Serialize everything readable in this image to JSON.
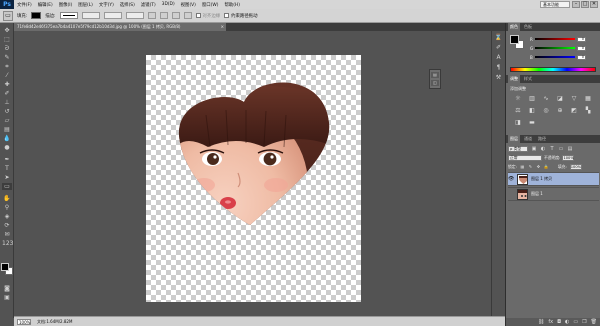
{
  "app": {
    "logo": "Ps"
  },
  "menu": [
    "文件(F)",
    "编辑(E)",
    "图像(I)",
    "图层(L)",
    "文字(Y)",
    "选择(S)",
    "滤镜(T)",
    "3D(D)",
    "视图(V)",
    "窗口(W)",
    "帮助(H)"
  ],
  "window_controls": {
    "minimize": "–",
    "maximize": "□",
    "close": "✕"
  },
  "workspace": "基本功能",
  "options": {
    "tool_icon": "▭",
    "fill_label": "填充:",
    "stroke_label": "描边:",
    "align_edges": "对齐边缘",
    "constrain_path": "约束路径拖动"
  },
  "document": {
    "tab_title": "71fe8d42e46f375ea7b4a4107e5f79cd12b10d3d.jpg @ 100% (图层 1 拷贝, RGB/8)",
    "tab_close": "×"
  },
  "status": {
    "zoom": "100%",
    "doc_info": "文档:1.64M/2.82M"
  },
  "panels": {
    "color": {
      "tabs": [
        "颜色",
        "色板"
      ],
      "sliders": [
        {
          "label": "R",
          "value": "0",
          "color": "#ff0000"
        },
        {
          "label": "G",
          "value": "0",
          "color": "#00ff00"
        },
        {
          "label": "B",
          "value": "0",
          "color": "#0000ff"
        }
      ]
    },
    "adjust": {
      "tabs": [
        "调整",
        "样式"
      ],
      "title": "添加调整"
    },
    "layers": {
      "tabs": [
        "图层",
        "通道",
        "路径"
      ],
      "kind": "ρ 类型",
      "blend": "正常",
      "opacity_label": "不透明度:",
      "opacity": "100%",
      "lock_label": "锁定:",
      "fill_label": "填充:",
      "fill": "100%",
      "items": [
        {
          "name": "图层 1 拷贝",
          "selected": true
        },
        {
          "name": "图层 1",
          "selected": false
        }
      ]
    }
  }
}
